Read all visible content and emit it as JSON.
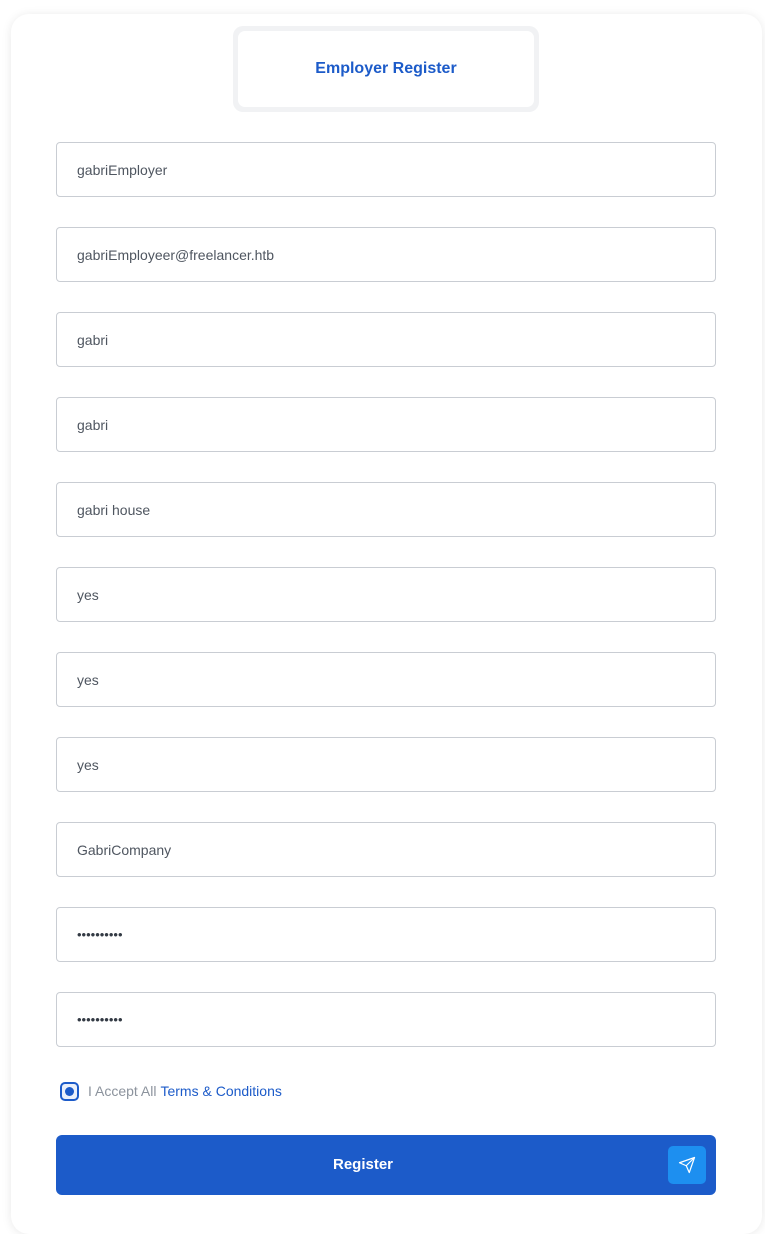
{
  "header": {
    "title": "Employer Register"
  },
  "form": {
    "fields": [
      {
        "name": "username",
        "value": "gabriEmployer"
      },
      {
        "name": "email",
        "value": "gabriEmployeer@freelancer.htb"
      },
      {
        "name": "first_name",
        "value": "gabri"
      },
      {
        "name": "last_name",
        "value": "gabri"
      },
      {
        "name": "address",
        "value": "gabri house"
      },
      {
        "name": "security_q1",
        "value": "yes"
      },
      {
        "name": "security_q2",
        "value": "yes"
      },
      {
        "name": "security_q3",
        "value": "yes"
      },
      {
        "name": "company_name",
        "value": "GabriCompany"
      },
      {
        "name": "password",
        "value": "••••••••••"
      },
      {
        "name": "confirm_password",
        "value": "••••••••••"
      }
    ],
    "accept": {
      "text": "I Accept All",
      "link": "Terms & Conditions",
      "checked": true
    },
    "submit": {
      "label": "Register",
      "icon": "send-icon"
    }
  },
  "colors": {
    "primary": "#1c5bc9",
    "send_box": "#1d8ff0",
    "border": "#c9cdd3"
  }
}
